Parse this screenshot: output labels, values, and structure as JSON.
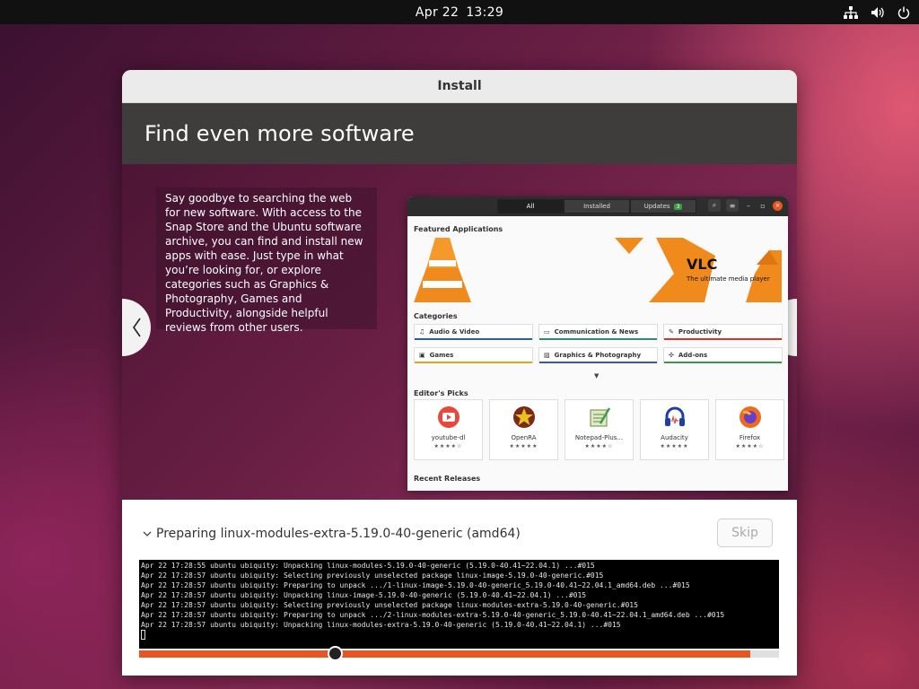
{
  "topbar": {
    "date": "Apr 22",
    "time": "13:29",
    "icons": [
      "network-icon",
      "volume-icon",
      "power-icon"
    ]
  },
  "window": {
    "title": "Install",
    "banner_title": "Find even more software",
    "slide_text": "Say goodbye to searching the web for new software. With access to the Snap Store and the Ubuntu software archive, you can find and install new apps with ease. Just type in what you’re looking for, or explore categories such as Graphics & Photography, Games and Productivity, alongside helpful reviews from other users.",
    "prev_icon": "chevron-left-icon",
    "next_icon": "chevron-right-icon"
  },
  "store": {
    "tabs": [
      {
        "label": "All"
      },
      {
        "label": "Installed"
      },
      {
        "label": "Updates",
        "badge": "3"
      }
    ],
    "featured_label": "Featured Applications",
    "featured_app": "VLC",
    "featured_tagline": "The ultimate media player",
    "categories_label": "Categories",
    "categories": [
      {
        "label": "Audio & Video",
        "icon": "music-note-icon",
        "color": "#2a5db0"
      },
      {
        "label": "Communication & News",
        "icon": "chat-icon",
        "color": "#2a8f6a"
      },
      {
        "label": "Productivity",
        "icon": "pencil-icon",
        "color": "#d8342c"
      },
      {
        "label": "Games",
        "icon": "dice-icon",
        "color": "#e2a51e"
      },
      {
        "label": "Graphics & Photography",
        "icon": "image-icon",
        "color": "#3a5a9c"
      },
      {
        "label": "Add-ons",
        "icon": "puzzle-icon",
        "color": "#3c9a3c"
      }
    ],
    "editors_picks_label": "Editor's Picks",
    "picks": [
      {
        "name": "youtube-dl",
        "stars": "★★★★☆",
        "icon": "play-icon"
      },
      {
        "name": "OpenRA",
        "stars": "★★★★★",
        "icon": "star-icon"
      },
      {
        "name": "Notepad-Plus...",
        "stars": "★★★★☆",
        "icon": "notepad-icon"
      },
      {
        "name": "Audacity",
        "stars": "★★★★★",
        "icon": "headphones-icon"
      },
      {
        "name": "Firefox",
        "stars": "★★★★☆",
        "icon": "firefox-icon"
      }
    ],
    "recent_label": "Recent Releases"
  },
  "progress": {
    "status": "Preparing linux-modules-extra-5.19.0-40-generic (amd64)",
    "expander_icon": "chevron-down-icon",
    "skip_label": "Skip",
    "fraction": 0.955,
    "log": [
      "Apr 22 17:28:55 ubuntu ubiquity: Unpacking linux-modules-5.19.0-40-generic (5.19.0-40.41~22.04.1) ...#015",
      "Apr 22 17:28:57 ubuntu ubiquity: Selecting previously unselected package linux-image-5.19.0-40-generic.#015",
      "Apr 22 17:28:57 ubuntu ubiquity: Preparing to unpack .../1-linux-image-5.19.0-40-generic_5.19.0-40.41~22.04.1_amd64.deb ...#015",
      "Apr 22 17:28:57 ubuntu ubiquity: Unpacking linux-image-5.19.0-40-generic (5.19.0-40.41~22.04.1) ...#015",
      "Apr 22 17:28:57 ubuntu ubiquity: Selecting previously unselected package linux-modules-extra-5.19.0-40-generic.#015",
      "Apr 22 17:28:57 ubuntu ubiquity: Preparing to unpack .../2-linux-modules-extra-5.19.0-40-generic_5.19.0-40.41~22.04.1_amd64.deb ...#015",
      "Apr 22 17:28:57 ubuntu ubiquity: Unpacking linux-modules-extra-5.19.0-40-generic (5.19.0-40.41~22.04.1) ...#015"
    ]
  },
  "colors": {
    "accent": "#e95420",
    "banner_bg": "#3f3d3c"
  }
}
